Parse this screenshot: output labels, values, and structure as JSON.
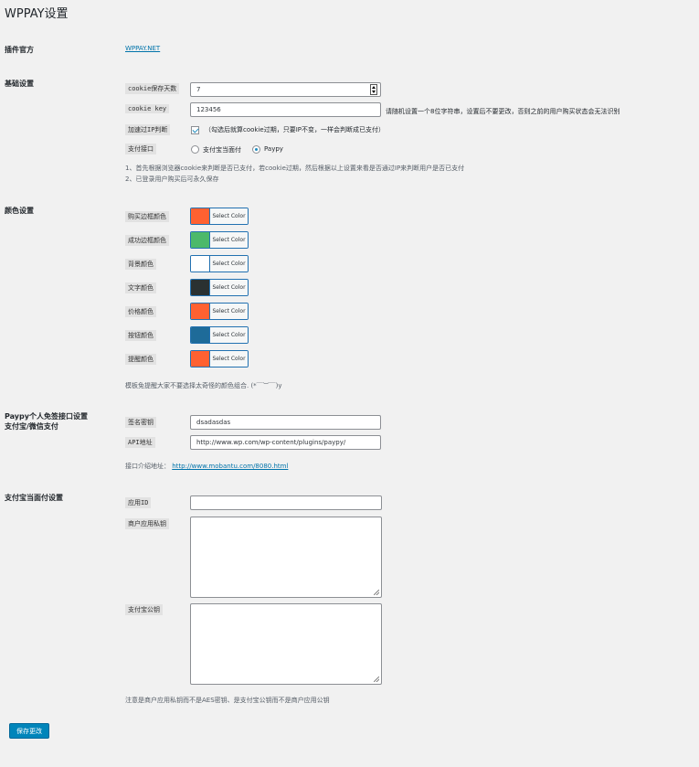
{
  "page": {
    "title": "WPPAY设置",
    "save_label": "保存更改"
  },
  "plugin": {
    "label": "插件官方",
    "link": "WPPAY.NET"
  },
  "basic": {
    "label": "基础设置",
    "cookie_days_label": "cookie保存天数",
    "cookie_days_value": "7",
    "cookie_key_label": "cookie key",
    "cookie_key_value": "123456",
    "cookie_key_hint": "请随机设置一个8位字符串，设置后不要更改，否则之前的用户购买状态会无法识别",
    "ip_label": "加速过IP判断",
    "ip_hint": "（勾选后就算cookie过期，只要IP不变，一样会判断成已支付）",
    "ip_checked": true,
    "payment_label": "支付接口",
    "payment_options": [
      "支付宝当面付",
      "Paypy"
    ],
    "payment_selected": "Paypy",
    "notes": [
      "1、首先根据浏览器cookie来判断是否已支付，若cookie过期，然后根据以上设置来看是否通过IP来判断用户是否已支付",
      "2、已登录用户购买后可永久保存"
    ]
  },
  "colors": {
    "label": "颜色设置",
    "select_label": "Select Color",
    "items": [
      {
        "label": "购买边框颜色",
        "color": "#ff6131"
      },
      {
        "label": "成功边框颜色",
        "color": "#4cb96a"
      },
      {
        "label": "背景颜色",
        "color": "#ffffff"
      },
      {
        "label": "文字颜色",
        "color": "#2a3131"
      },
      {
        "label": "价格颜色",
        "color": "#ff6131"
      },
      {
        "label": "按钮颜色",
        "color": "#1e6b99"
      },
      {
        "label": "提醒颜色",
        "color": "#ff6131"
      }
    ],
    "note": "模板免提醒大家不要选择太奇怪的颜色组合. (*￣︶￣)y"
  },
  "paypy": {
    "label_line1": "Paypy个人免签接口设置",
    "label_line2": "支付宝/微信支付",
    "key_label": "签名密钥",
    "key_value": "dsadasdas",
    "api_label": "API地址",
    "api_value": "http://www.wp.com/wp-content/plugins/paypy/",
    "intro_prefix": "接口介绍地址：",
    "intro_link": "http://www.mobantu.com/8080.html"
  },
  "alipay": {
    "label": "支付宝当面付设置",
    "appid_label": "应用ID",
    "appid_value": "",
    "private_key_label": "商户应用私钥",
    "public_key_label": "支付宝公钥",
    "note": "注意是商户应用私钥而不是AES密钥、是支付宝公钥而不是商户应用公钥"
  }
}
